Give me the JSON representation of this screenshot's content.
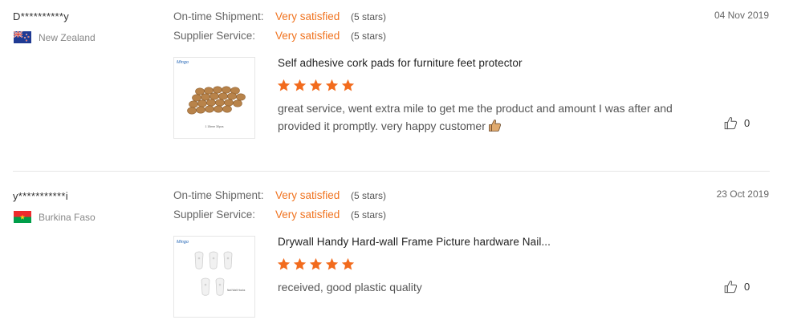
{
  "reviews": [
    {
      "user": "D**********y",
      "country": "New Zealand",
      "date": "04 Nov 2019",
      "shipment_label": "On-time Shipment:",
      "shipment_value": "Very satisfied",
      "shipment_stars": "(5 stars)",
      "service_label": "Supplier Service:",
      "service_value": "Very satisfied",
      "service_stars": "(5 stars)",
      "product_title": "Self adhesive cork pads for furniture feet protector",
      "rating": 5,
      "feedback": "great service, went extra mile to get me the product and amount I was after and provided it promptly. very happy customer",
      "thumb_brand": "Mingo",
      "thumb_caption": "1 15mm 30pcs",
      "helpful_count": "0"
    },
    {
      "user": "y***********i",
      "country": "Burkina Faso",
      "date": "23 Oct 2019",
      "shipment_label": "On-time Shipment:",
      "shipment_value": "Very satisfied",
      "shipment_stars": "(5 stars)",
      "service_label": "Supplier Service:",
      "service_value": "Very satisfied",
      "service_stars": "(5 stars)",
      "product_title": "Drywall Handy Hard-wall Frame Picture hardware Nail...",
      "rating": 5,
      "feedback": "received, good plastic quality",
      "thumb_brand": "Mingo",
      "thumb_caption": "Nail Wall Hooks",
      "helpful_count": "0"
    }
  ],
  "colors": {
    "accent": "#f0731f",
    "star": "#f26b1d",
    "divider": "#e6e6e6"
  },
  "icons": {
    "helpful": "thumbs-up-outline-icon",
    "emoji": "thumbs-up-emoji-icon",
    "star": "star-icon"
  }
}
